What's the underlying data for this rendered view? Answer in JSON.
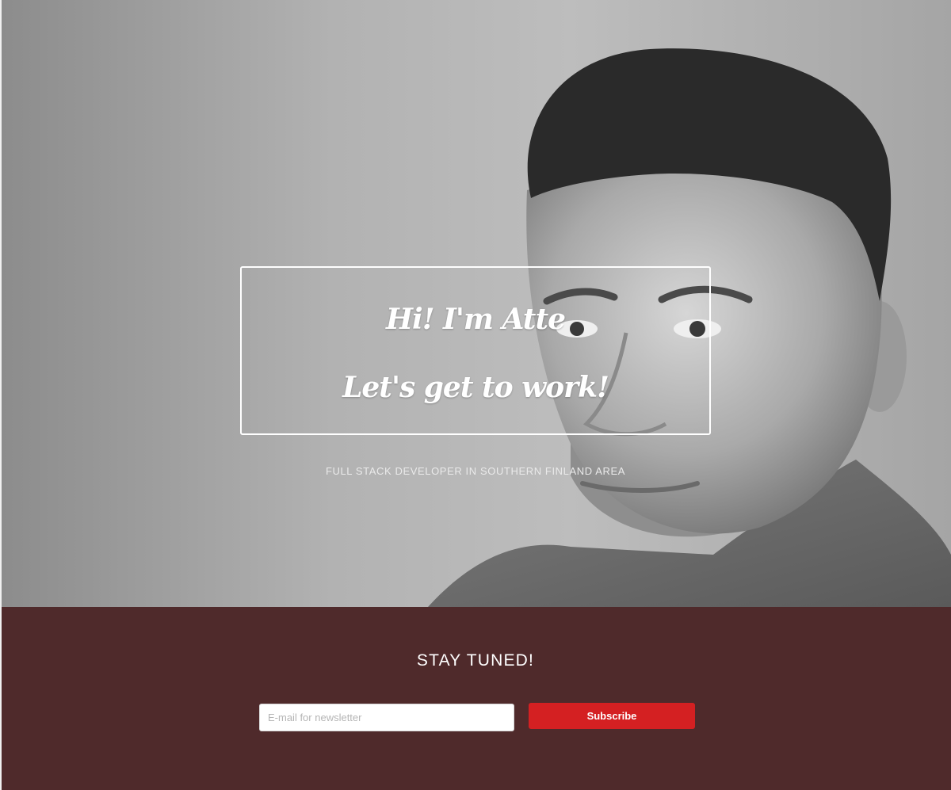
{
  "hero": {
    "title_line1": "Hi! I'm Atte",
    "title_line2": "Let's get to work!",
    "subtitle": "FULL STACK DEVELOPER IN SOUTHERN FINLAND AREA"
  },
  "newsletter": {
    "heading": "STAY TUNED!",
    "email_placeholder": "E-mail for newsletter",
    "email_value": "",
    "subscribe_label": "Subscribe"
  },
  "colors": {
    "newsletter_bg": "#4f2a2b",
    "subscribe_bg": "#d42022",
    "text_light": "#ffffff"
  }
}
